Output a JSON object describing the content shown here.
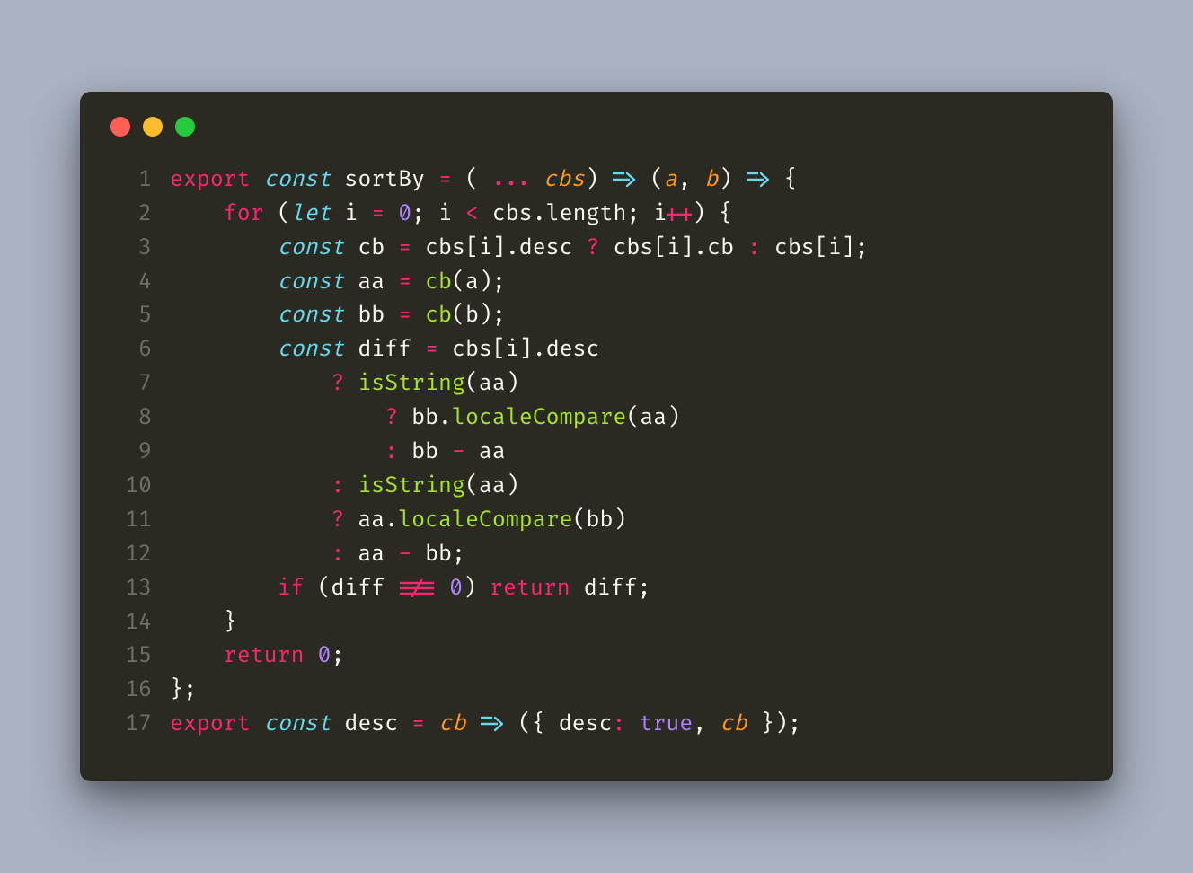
{
  "window": {
    "traffic_lights": [
      "close",
      "minimize",
      "zoom"
    ]
  },
  "theme": {
    "background": "#aab2c3",
    "editor_bg": "#2a2a22",
    "colors": {
      "keyword_pink": "#f92672",
      "keyword_blue_italic": "#66d9ef",
      "function_green": "#a6e22e",
      "param_orange": "#fd971f",
      "number_purple": "#ae81ff",
      "text": "#f8f8ee",
      "line_number": "#6f7065"
    }
  },
  "code": {
    "language": "javascript",
    "lines": [
      {
        "n": 1,
        "text": "export const sortBy = ( ... cbs) => (a, b) => {"
      },
      {
        "n": 2,
        "text": "    for (let i = 0; i < cbs.length; i++) {"
      },
      {
        "n": 3,
        "text": "        const cb = cbs[i].desc ? cbs[i].cb : cbs[i];"
      },
      {
        "n": 4,
        "text": "        const aa = cb(a);"
      },
      {
        "n": 5,
        "text": "        const bb = cb(b);"
      },
      {
        "n": 6,
        "text": "        const diff = cbs[i].desc"
      },
      {
        "n": 7,
        "text": "            ? isString(aa)"
      },
      {
        "n": 8,
        "text": "                ? bb.localeCompare(aa)"
      },
      {
        "n": 9,
        "text": "                : bb - aa"
      },
      {
        "n": 10,
        "text": "            : isString(aa)"
      },
      {
        "n": 11,
        "text": "            ? aa.localeCompare(bb)"
      },
      {
        "n": 12,
        "text": "            : aa - bb;"
      },
      {
        "n": 13,
        "text": "        if (diff !== 0) return diff;"
      },
      {
        "n": 14,
        "text": "    }"
      },
      {
        "n": 15,
        "text": "    return 0;"
      },
      {
        "n": 16,
        "text": "};"
      },
      {
        "n": 17,
        "text": "export const desc = cb => ({ desc: true, cb });"
      }
    ]
  }
}
